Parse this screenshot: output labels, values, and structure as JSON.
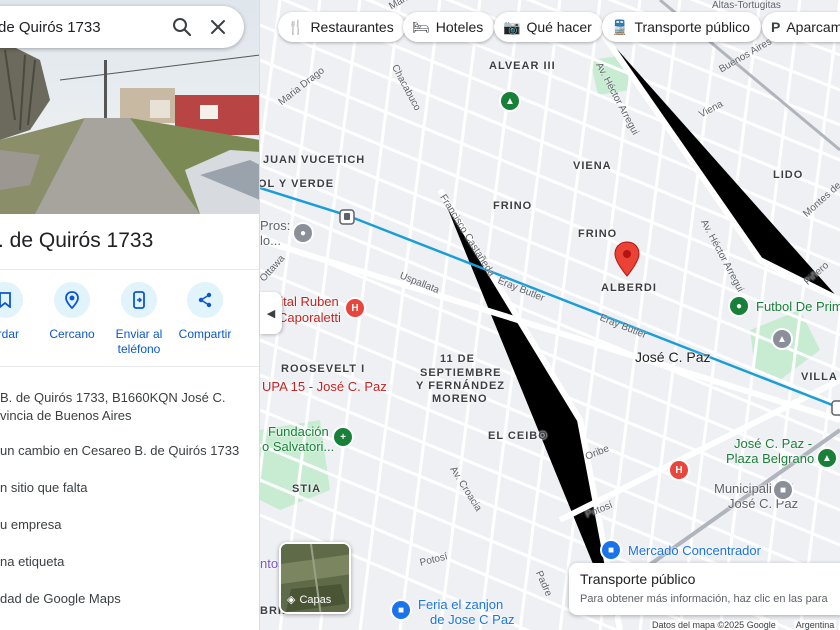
{
  "search": {
    "value": "de Quirós 1733"
  },
  "place": {
    "title": ". de Quirós 1733"
  },
  "actions": [
    {
      "label": "ardar",
      "icon": "bookmark-icon"
    },
    {
      "label": "Cercano",
      "icon": "nearby-icon"
    },
    {
      "label": "Enviar al teléfono",
      "icon": "send-to-phone-icon"
    },
    {
      "label": "Compartir",
      "icon": "share-icon"
    }
  ],
  "details": {
    "address_line1": "B. de Quirós 1733, B1660KQN José C.",
    "address_line2": "vincia de Buenos Aires",
    "suggest_edit": "un cambio en Cesareo B. de Quirós 1733",
    "add_missing": "n sitio que falta",
    "add_business": "u empresa",
    "add_label": "na etiqueta",
    "your_maps": "dad de Google Maps"
  },
  "chips": [
    {
      "label": "Restaurantes",
      "icon": "restaurant-icon"
    },
    {
      "label": "Hoteles",
      "icon": "hotel-icon"
    },
    {
      "label": "Qué hacer",
      "icon": "camera-icon"
    },
    {
      "label": "Transporte público",
      "icon": "transit-icon"
    },
    {
      "label": "Aparcam",
      "icon": "parking-icon"
    }
  ],
  "map": {
    "neighborhoods": {
      "alvear": "ALVEAR III",
      "vucetich": "JUAN VUCETICH",
      "olyverde": "OL Y VERDE",
      "viena": "VIENA",
      "lido": "LIDO",
      "frino1": "FRINO",
      "frino2": "FRINO",
      "alberdi": "ALBERDI",
      "roosevelt": "ROOSEVELT I",
      "septiembre1": "11 DE",
      "septiembre2": "SEPTIEMBRE",
      "septiembre3": "Y FERNÁNDEZ",
      "septiembre4": "MORENO",
      "ceibo": "EL CEIBO",
      "stia": "STIA",
      "villa": "VILLA",
      "abril": "BRIL"
    },
    "streets": {
      "drago": "Maria Drago",
      "chacabuco": "Chacabuco",
      "arregui1": "Av. Héctor Arregui",
      "arregui2": "Av. Héctor Arregui",
      "buenosaires": "Buenos Aires",
      "viena": "Viena",
      "castaneda": "Francisco Castañeda",
      "eray1": "Eray Butler",
      "eray2": "Eray Butler",
      "uspallata": "Uspallata",
      "ottawa": "Ottawa",
      "montes": "Montes de Oca",
      "pinero": "Piñero",
      "croacia": "Av. Croacia",
      "oribe": "Oribe",
      "potosi1": "Potosí",
      "potosi2": "Potosí",
      "padre": "Padre",
      "altas": "Altas-Tortugitas",
      "maria": "Maria"
    },
    "pois": {
      "pros1": "Pros:",
      "pros2": "lo...",
      "hospital1": "pital Ruben",
      "hospital2": "Caporaletti",
      "upa": "UPA 15 - José C. Paz",
      "fundacion1": "Fundación",
      "fundacion2": "o Salvatori...",
      "futbol": "Futbol De Prim",
      "jcpaz": "José C. Paz",
      "plaza1": "José C. Paz -",
      "plaza2": "Plaza Belgrano",
      "muni1": "Municipalidad",
      "muni2": "José C. Paz",
      "mercado": "Mercado Concentrador",
      "feria1": "Feria el zanjon",
      "feria2": "de Jose C Paz",
      "ntos": "ntos"
    }
  },
  "layers": {
    "label": "Capas"
  },
  "transit_card": {
    "title": "Transporte público",
    "subtitle": "Para obtener más información, haz clic en las para"
  },
  "footer": {
    "map_data": "Datos del mapa ©2025 Google",
    "country": "Argentina"
  },
  "colors": {
    "accent": "#0b57d0",
    "transit_line": "#1a9ed8",
    "pin": "#ea4335",
    "park": "#c8ecd2"
  }
}
